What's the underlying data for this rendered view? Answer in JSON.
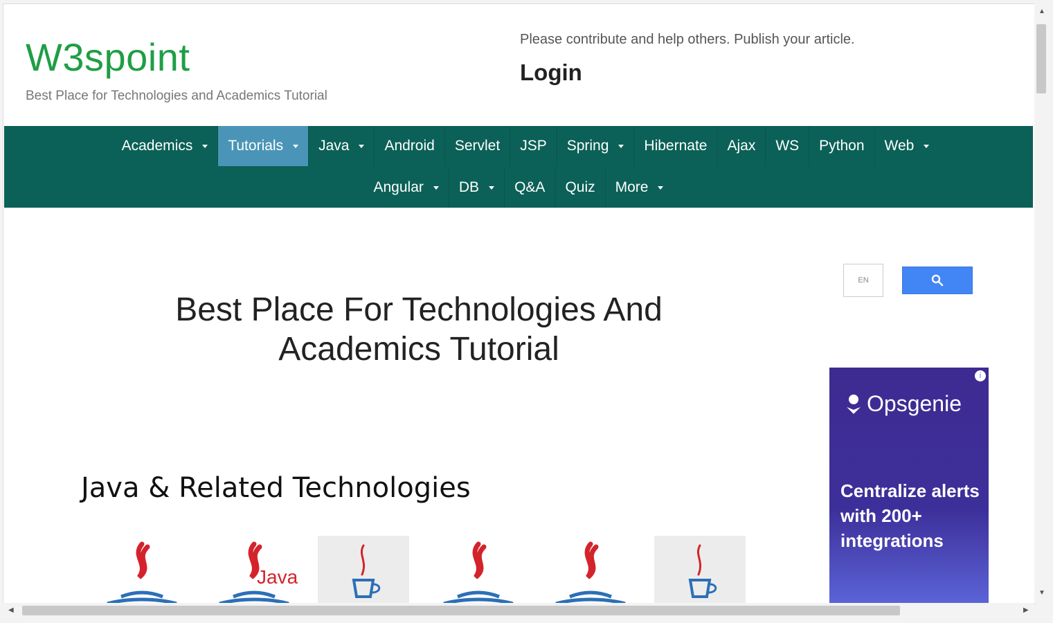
{
  "header": {
    "logo": "W3spoint",
    "tagline": "Best Place for Technologies and Academics Tutorial",
    "contribute": "Please contribute and help others. Publish your article.",
    "login": "Login"
  },
  "nav": {
    "row1": [
      {
        "label": "Academics",
        "dropdown": true
      },
      {
        "label": "Tutorials",
        "dropdown": true,
        "active": true
      },
      {
        "label": "Java",
        "dropdown": true
      },
      {
        "label": "Android",
        "dropdown": false
      },
      {
        "label": "Servlet",
        "dropdown": false
      },
      {
        "label": "JSP",
        "dropdown": false
      },
      {
        "label": "Spring",
        "dropdown": true
      },
      {
        "label": "Hibernate",
        "dropdown": false
      },
      {
        "label": "Ajax",
        "dropdown": false
      },
      {
        "label": "WS",
        "dropdown": false
      },
      {
        "label": "Python",
        "dropdown": false
      },
      {
        "label": "Web",
        "dropdown": true
      }
    ],
    "row2": [
      {
        "label": "Angular",
        "dropdown": true
      },
      {
        "label": "DB",
        "dropdown": true
      },
      {
        "label": "Q&A",
        "dropdown": false
      },
      {
        "label": "Quiz",
        "dropdown": false
      },
      {
        "label": "More",
        "dropdown": true
      }
    ]
  },
  "search": {
    "lang": "EN",
    "button_icon": "search-icon"
  },
  "main": {
    "hero_line1": "Best Place For Technologies And",
    "hero_line2": "Academics Tutorial",
    "section_title": "Java & Related Technologies"
  },
  "ad": {
    "brand": "Opsgenie",
    "text": "Centralize alerts with 200+ integrations",
    "info_icon": "info-icon"
  },
  "thumbnails": [
    {
      "icon": "java-logo-icon",
      "label": ""
    },
    {
      "icon": "java-logo-icon",
      "label": "Java"
    },
    {
      "icon": "java-logo-icon",
      "label": ""
    },
    {
      "icon": "java-logo-icon",
      "label": ""
    },
    {
      "icon": "java-logo-icon",
      "label": ""
    },
    {
      "icon": "java-logo-icon",
      "label": ""
    }
  ],
  "colors": {
    "logo": "#1f9e45",
    "nav_bg": "#0b6157",
    "nav_active": "#4a95b7",
    "search_button": "#4285f4",
    "ad_bg": "#3e2b92",
    "java_red": "#d4232b",
    "java_blue": "#2c6fb7"
  }
}
